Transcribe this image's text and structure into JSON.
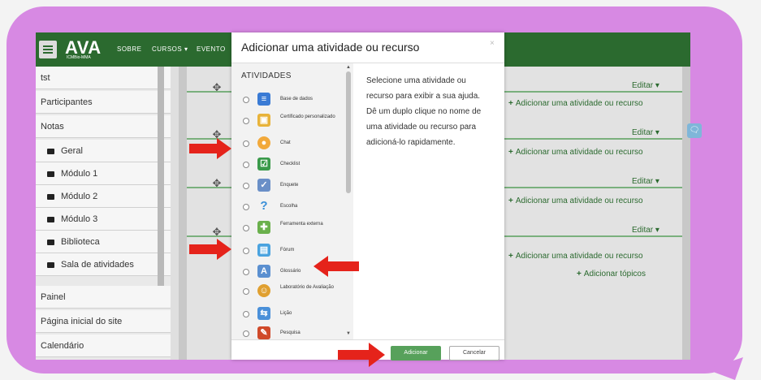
{
  "navbar": {
    "logo": "AVA",
    "logo_sub": "ICMBio-MMA",
    "links": [
      "SOBRE",
      "CURSOS ▾",
      "EVENTO"
    ]
  },
  "sidebar": {
    "items": [
      {
        "label": "tst",
        "folder": false
      },
      {
        "label": "Participantes",
        "folder": false
      },
      {
        "label": "Notas",
        "folder": false
      },
      {
        "label": "Geral",
        "folder": true
      },
      {
        "label": "Módulo 1",
        "folder": true
      },
      {
        "label": "Módulo 2",
        "folder": true
      },
      {
        "label": "Módulo 3",
        "folder": true
      },
      {
        "label": "Biblioteca",
        "folder": true
      },
      {
        "label": "Sala de atividades",
        "folder": true
      },
      {
        "label": "Painel",
        "folder": false
      },
      {
        "label": "Página inicial do site",
        "folder": false
      },
      {
        "label": "Calendário",
        "folder": false
      }
    ]
  },
  "main": {
    "edit_label": "Editar ▾",
    "add_activity_label": "Adicionar uma atividade ou recurso",
    "add_topics_label": "Adicionar tópicos"
  },
  "modal": {
    "title": "Adicionar uma atividade ou recurso",
    "close": "×",
    "list_heading": "ATIVIDADES",
    "activities": [
      {
        "label": "Base de dados",
        "icon": "database-icon",
        "color": "#3a7bd5"
      },
      {
        "label": "Certificado personalizado",
        "icon": "certificate-icon",
        "color": "#e8b33a"
      },
      {
        "label": "Chat",
        "icon": "chat-icon",
        "color": "#f2a93b"
      },
      {
        "label": "Checklist",
        "icon": "checklist-icon",
        "color": "#3a9a4a"
      },
      {
        "label": "Enquete",
        "icon": "poll-icon",
        "color": "#6a8fc7"
      },
      {
        "label": "Escolha",
        "icon": "question-icon",
        "color": "#3a8fd8"
      },
      {
        "label": "Ferramenta externa",
        "icon": "puzzle-icon",
        "color": "#6ab04c"
      },
      {
        "label": "Fórum",
        "icon": "forum-icon",
        "color": "#4aa3df"
      },
      {
        "label": "Glossário",
        "icon": "glossary-icon",
        "color": "#5a8fd0"
      },
      {
        "label": "Laboratório de Avaliação",
        "icon": "workshop-icon",
        "color": "#e0a030"
      },
      {
        "label": "Lição",
        "icon": "lesson-icon",
        "color": "#4a90d9"
      },
      {
        "label": "Pesquisa",
        "icon": "survey-icon",
        "color": "#d04a2a"
      }
    ],
    "description": "Selecione uma atividade ou recurso para exibir a sua ajuda. Dê um duplo clique no nome de uma atividade ou recurso para adicioná-lo rapidamente.",
    "add_button": "Adicionar",
    "cancel_button": "Cancelar"
  },
  "colors": {
    "frame": "#d789e3",
    "navbar": "#2b6a2f",
    "accent_green": "#57a15b",
    "arrow_red": "#e5231b"
  }
}
